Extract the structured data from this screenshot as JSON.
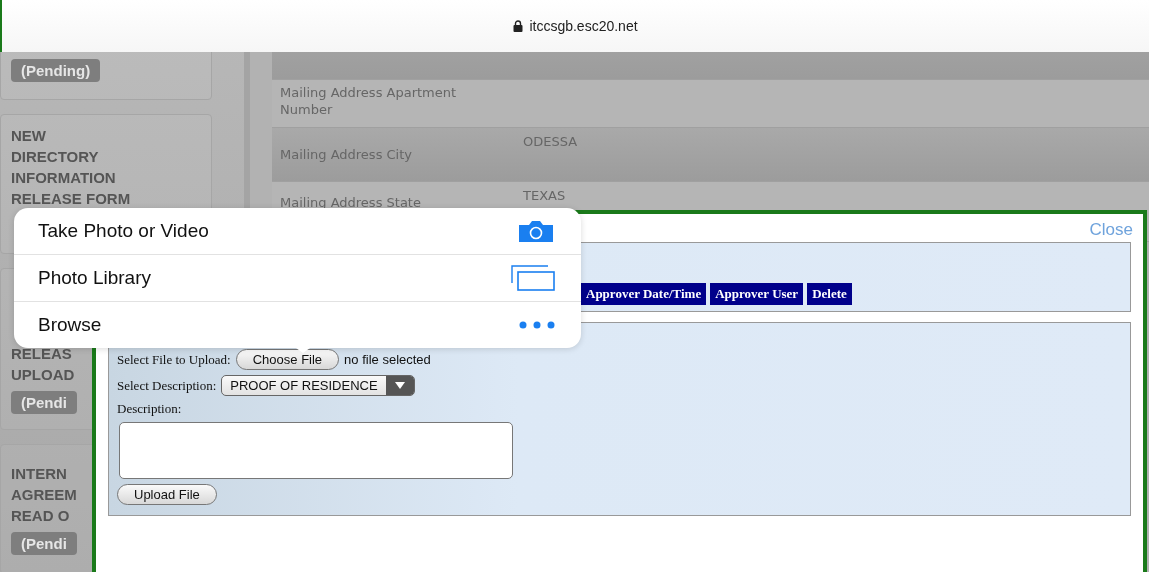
{
  "address_bar": {
    "url": "itccsgb.esc20.net"
  },
  "sidebar": {
    "cards": [
      {
        "badge": "(Pending)"
      },
      {
        "lines": [
          "NEW",
          "DIRECTORY",
          "INFORMATION",
          "RELEASE FORM"
        ]
      },
      {
        "lines": [
          "RELEAS",
          "UPLOAD"
        ],
        "badge": "(Pendi"
      },
      {
        "lines": [
          "INTERN",
          "AGREEM",
          "READ O"
        ],
        "badge": "(Pendi"
      }
    ]
  },
  "details": {
    "rows": [
      {
        "label": "Mailing Address Apartment Number"
      },
      {
        "label": "Mailing Address City",
        "value": "ODESSA"
      },
      {
        "label": "Mailing Address State",
        "value": "TEXAS"
      }
    ]
  },
  "upload_dialog": {
    "close": "Close",
    "columns": [
      "Approver Date/Time",
      "Approver User",
      "Delete"
    ],
    "file_label": "Select File to Upload:",
    "choose_button": "Choose File",
    "file_status": "no file selected",
    "description_select_label": "Select Description:",
    "description_select": "PROOF OF RESIDENCE",
    "description_label": "Description:",
    "upload_button": "Upload File"
  },
  "file_source_menu": {
    "items": [
      {
        "label": "Take Photo or Video",
        "kind": "camera"
      },
      {
        "label": "Photo Library",
        "kind": "library"
      },
      {
        "label": "Browse",
        "kind": "more"
      }
    ]
  }
}
